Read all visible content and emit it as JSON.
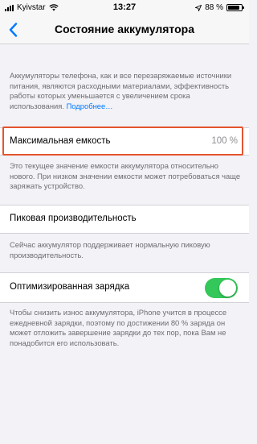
{
  "status_bar": {
    "carrier": "Kyivstar",
    "time": "13:27",
    "battery_percent": "88 %",
    "battery_level": 0.88
  },
  "nav": {
    "title": "Состояние аккумулятора",
    "back_icon": "chevron-left-icon"
  },
  "intro": {
    "text": "Аккумуляторы телефона, как и все перезаряжаемые источники питания, являются расходными материалами, эффективность работы которых уменьшается с увеличением срока использования. ",
    "link": "Подробнее…"
  },
  "max_capacity": {
    "label": "Максимальная емкость",
    "value": "100 %",
    "caption": "Это текущее значение емкости аккумулятора относительно нового. При низком значении емкости может потребоваться чаще заряжать устройство."
  },
  "peak_performance": {
    "label": "Пиковая производительность",
    "caption": "Сейчас аккумулятор поддерживает нормальную пиковую производительность."
  },
  "optimized_charging": {
    "label": "Оптимизированная зарядка",
    "enabled": true,
    "caption": "Чтобы снизить износ аккумулятора, iPhone учится в процессе ежедневной зарядки, поэтому по достижении 80 % заряда он может отложить завершение зарядки до тех пор, пока Вам не понадобится его использовать."
  },
  "colors": {
    "accent": "#007aff",
    "toggle_on": "#34c759",
    "highlight": "#e4542e",
    "background": "#f2f2f7"
  }
}
